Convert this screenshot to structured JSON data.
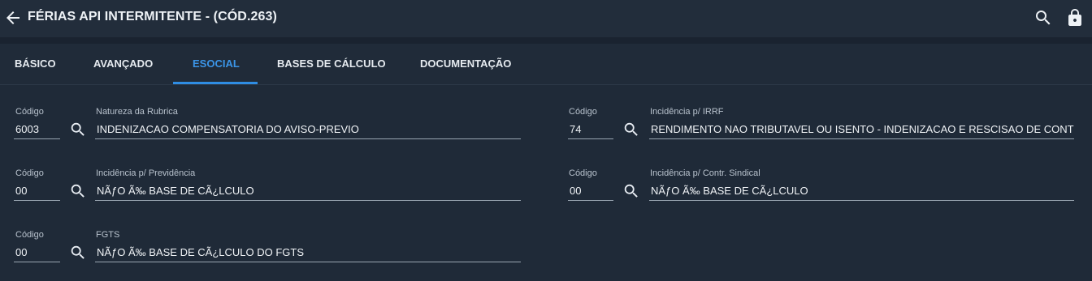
{
  "header": {
    "title": "FÉRIAS API INTERMITENTE - (CÓD.263)",
    "icons": [
      "back-arrow-icon",
      "search-icon",
      "lock-icon"
    ]
  },
  "tabs": [
    {
      "label": "BÁSICO",
      "active": false
    },
    {
      "label": "AVANÇADO",
      "active": false
    },
    {
      "label": "ESOCIAL",
      "active": true
    },
    {
      "label": "BASES DE CÁLCULO",
      "active": false
    },
    {
      "label": "DOCUMENTAÇÃO",
      "active": false
    }
  ],
  "colors": {
    "background": "#1f2a38",
    "accent": "#3b95e8",
    "text": "#e8edf3"
  },
  "fields": {
    "natureza": {
      "code_label": "Código",
      "code": "6003",
      "desc_label": "Natureza da Rubrica",
      "desc": "INDENIZACAO COMPENSATORIA DO AVISO-PREVIO"
    },
    "irrf": {
      "code_label": "Código",
      "code": "74",
      "desc_label": "Incidência p/ IRRF",
      "desc": "RENDIMENTO NAO TRIBUTAVEL OU ISENTO - INDENIZACAO E RESCISAO DE CONTRATO, I"
    },
    "previdencia": {
      "code_label": "Código",
      "code": "00",
      "desc_label": "Incidência p/ Previdência",
      "desc": "NÃƒO Ã‰ BASE DE CÃ¿LCULO"
    },
    "sindical": {
      "code_label": "Código",
      "code": "00",
      "desc_label": "Incidência p/ Contr. Sindical",
      "desc": "NÃƒO Ã‰ BASE DE CÃ¿LCULO"
    },
    "fgts": {
      "code_label": "Código",
      "code": "00",
      "desc_label": "FGTS",
      "desc": "NÃƒO Ã‰ BASE DE CÃ¿LCULO DO FGTS"
    }
  }
}
